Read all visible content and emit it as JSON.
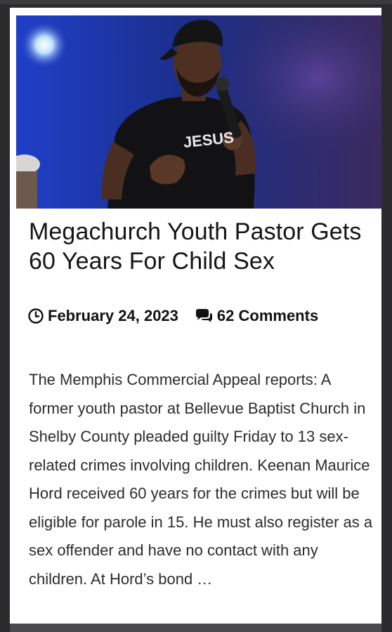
{
  "article": {
    "title": "Megachurch Youth Pastor Gets 60 Years For Child Sex",
    "date": "February 24, 2023",
    "comments": "62 Comments",
    "excerpt": "The Memphis Commercial Appeal reports: A former youth pastor at Bellevue Baptist Church in Shelby County pleaded guilty Friday to 13 sex-related crimes involving children. Keenan Maurice Hord received 60 years for the crimes but will be eligible for parole in 15. He must also register as a sex offender and have no contact with any children. At Hord’s bond …",
    "shirt_text": "JESUS"
  },
  "icons": {
    "date": "clock-icon",
    "comments": "comments-icon"
  }
}
